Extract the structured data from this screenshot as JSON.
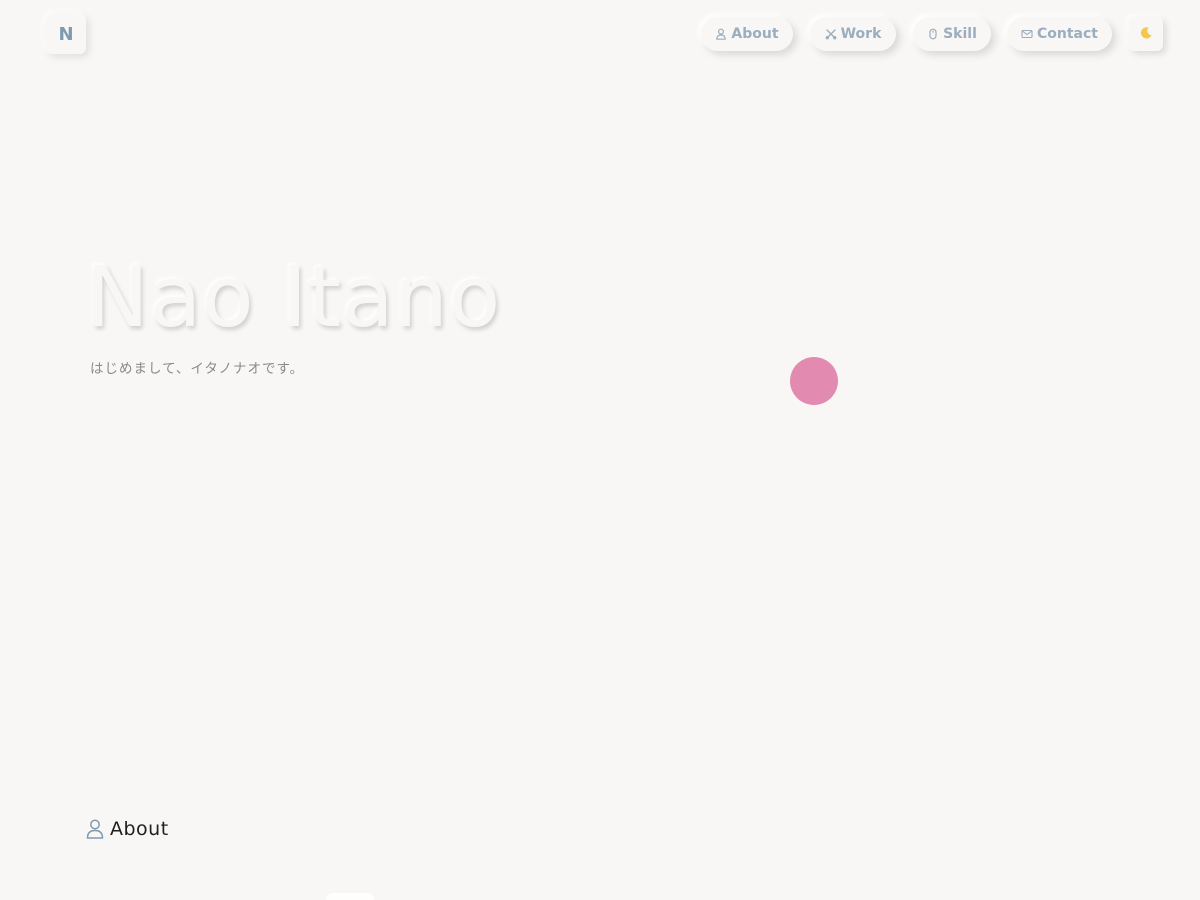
{
  "header": {
    "logo_letter": "N",
    "nav": [
      {
        "label": "About",
        "icon": "person-icon"
      },
      {
        "label": "Work",
        "icon": "tools-icon"
      },
      {
        "label": "Skill",
        "icon": "mouse-icon"
      },
      {
        "label": "Contact",
        "icon": "mail-icon"
      }
    ],
    "theme_toggle_icon": "moon-icon"
  },
  "hero": {
    "title": "Nao Itano",
    "subtitle": "はじめまして、イタノナオです。"
  },
  "sections": {
    "about": {
      "heading": "About",
      "icon": "person-icon"
    }
  },
  "colors": {
    "background": "#f8f7f5",
    "nav_text": "#9aaec0",
    "logo_text": "#7e9ab1",
    "moon": "#f2c94c",
    "accent_dot": "#e38ab1",
    "heading_icon": "#7e9ab1"
  }
}
